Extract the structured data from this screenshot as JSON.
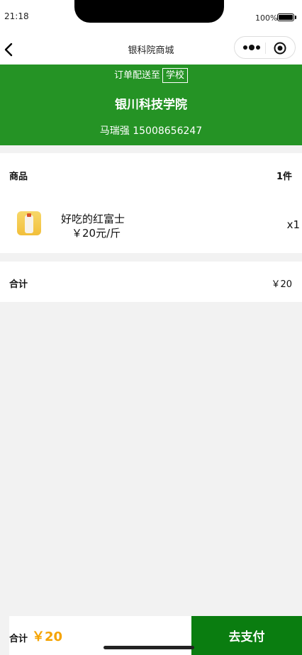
{
  "status_bar": {
    "time": "21:18",
    "battery": "100%"
  },
  "nav": {
    "title": "银科院商城"
  },
  "address": {
    "prefix": "订单配送至",
    "tag": "学校",
    "name": "银川科技学院",
    "contact": "马瑞强 15008656247"
  },
  "goods": {
    "header_label": "商品",
    "count": "1件",
    "items": [
      {
        "name": "好吃的红富士",
        "price": "￥20元/斤",
        "qty": "x1"
      }
    ]
  },
  "summary": {
    "label": "合计",
    "value": "￥20"
  },
  "bottom_bar": {
    "total_label": "合计",
    "total_value": "￥20",
    "pay_label": "去支付"
  },
  "colors": {
    "brand_green": "#259325",
    "pay_green": "#0a7d10",
    "price_orange": "#f5a300"
  }
}
